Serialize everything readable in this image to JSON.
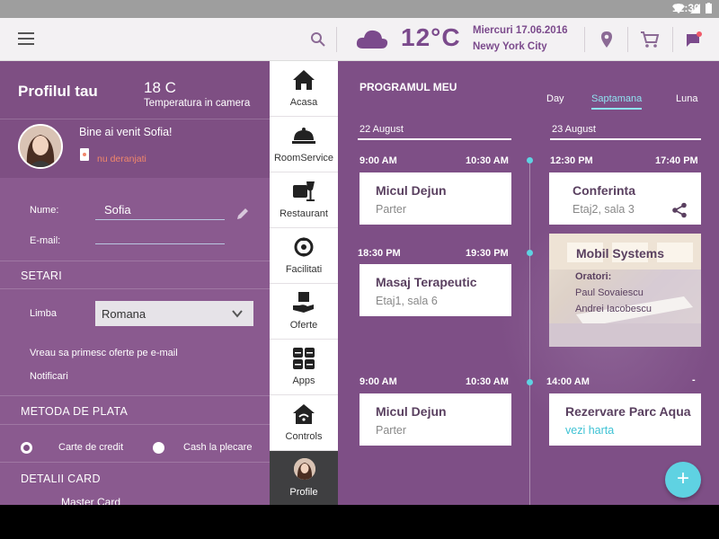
{
  "status": {
    "time": "12:30"
  },
  "header": {
    "temperature": "12°C",
    "date": "Miercuri 17.06.2016",
    "city": "Newy York City"
  },
  "profile": {
    "title": "Profilul tau",
    "room_temp": "18 C",
    "room_temp_label": "Temperatura in camera",
    "welcome": "Bine ai venit Sofia!",
    "dnd": "nu deranjati",
    "name_label": "Nume:",
    "name_value": "Sofia",
    "email_label": "E-mail:",
    "email_value": "",
    "settings_header": "SETARI",
    "language_label": "Limba",
    "language_value": "Romana",
    "offers_email": "Vreau sa primesc oferte pe e-mail",
    "notifications": "Notificari",
    "payment_header": "METODA DE PLATA",
    "payment_option_card": "Carte de credit",
    "payment_option_cash": "Cash la plecare",
    "card_details_header": "DETALII CARD",
    "card_type": "Master Card"
  },
  "nav": {
    "items": [
      {
        "label": "Acasa",
        "icon": "home-icon"
      },
      {
        "label": "RoomService",
        "icon": "cloche-icon"
      },
      {
        "label": "Restaurant",
        "icon": "restaurant-icon"
      },
      {
        "label": "Facilitati",
        "icon": "facilities-icon"
      },
      {
        "label": "Oferte",
        "icon": "offers-icon"
      },
      {
        "label": "Apps",
        "icon": "apps-icon"
      },
      {
        "label": "Controls",
        "icon": "controls-icon"
      },
      {
        "label": "Profile",
        "icon": "avatar"
      }
    ]
  },
  "schedule": {
    "title": "PROGRAMUL MEU",
    "tabs": [
      "Day",
      "Saptamana",
      "Luna"
    ],
    "active_tab": "Saptamana",
    "day1": "22 August",
    "day2": "23 August",
    "events": [
      {
        "start": "9:00 AM",
        "end": "10:30 AM",
        "title": "Micul Dejun",
        "sub": "Parter"
      },
      {
        "start": "18:30 PM",
        "end": "19:30 PM",
        "title": "Masaj Terapeutic",
        "sub": "Etaj1, sala 6"
      },
      {
        "start": "9:00 AM",
        "end": "10:30 AM",
        "title": "Micul Dejun",
        "sub": "Parter"
      },
      {
        "start": "12:30 PM",
        "end": "17:40 PM",
        "title": "Conferinta",
        "sub": "Etaj2, sala 3"
      },
      {
        "title": "Mobil Systems",
        "speakers_label": "Oratori:",
        "speaker1": "Paul Sovaiescu",
        "speaker2": "Andrei Iacobescu"
      },
      {
        "start": "14:00 AM",
        "end": "-",
        "title": "Rezervare Parc Aqua",
        "sub": "vezi harta"
      }
    ]
  },
  "colors": {
    "accent": "#5fd2e2",
    "purple": "#7e4f83",
    "dnd": "#f0876b"
  }
}
